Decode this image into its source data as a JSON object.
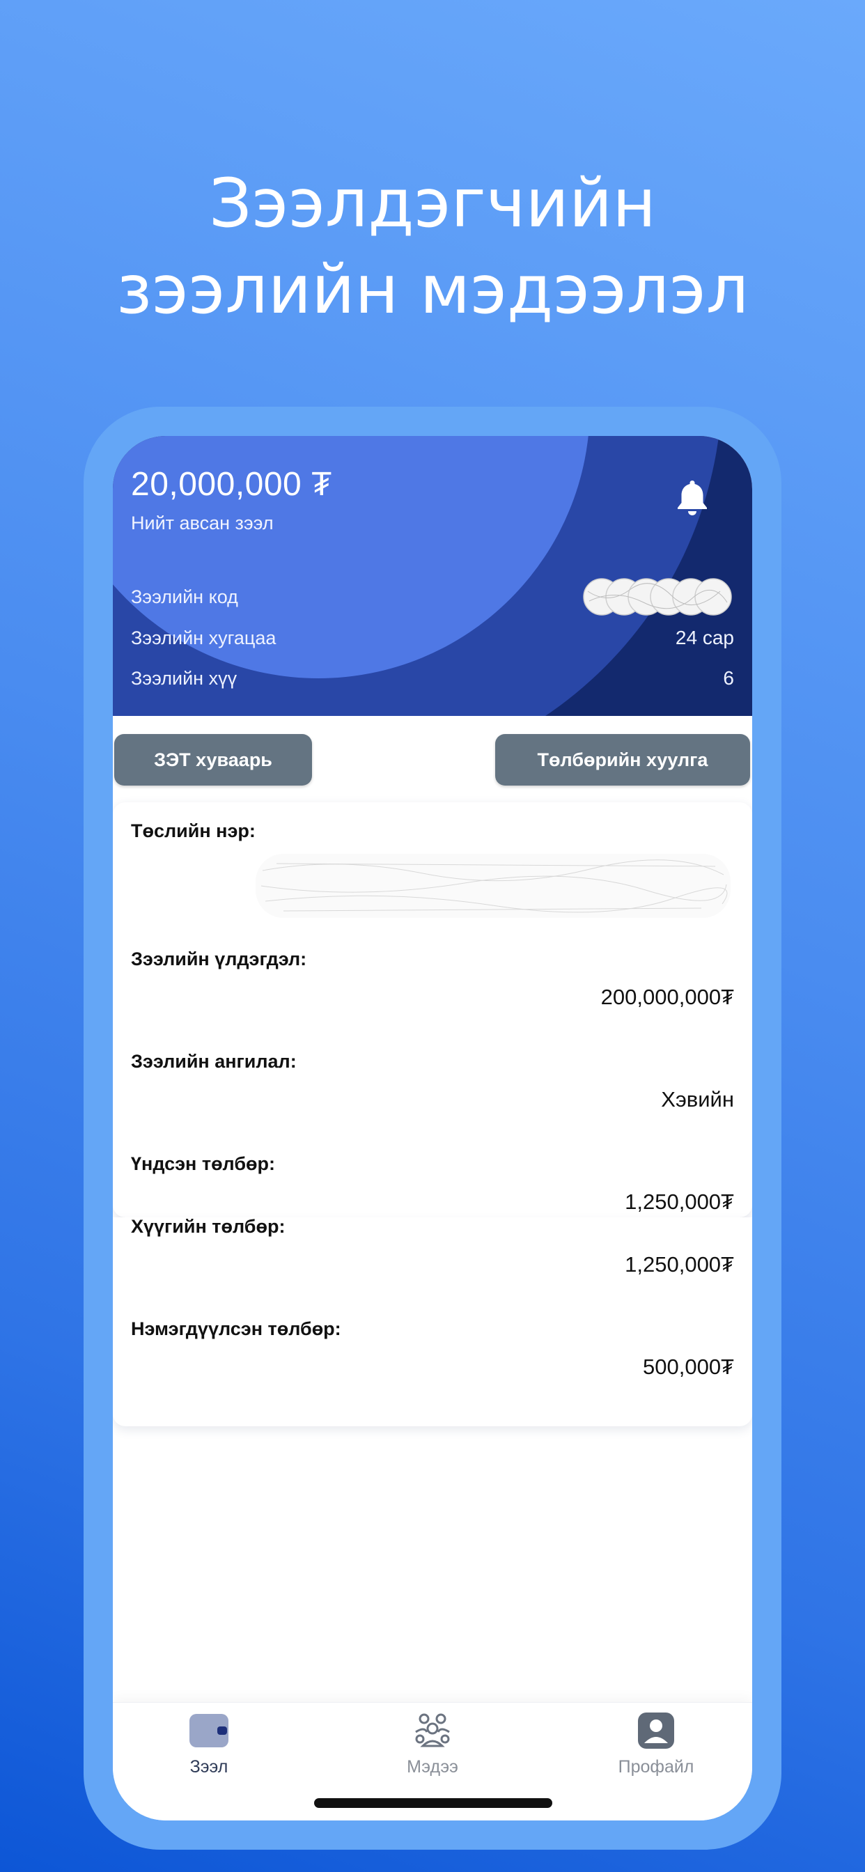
{
  "headline": {
    "line1": "Зээлдэгчийн",
    "line2": "зээлийн мэдээлэл"
  },
  "loan_card": {
    "amount": "20,000,000 ₮",
    "total_label": "Нийт авсан зээл",
    "notification_icon": "bell-icon",
    "rows": [
      {
        "label": "Зээлийн код",
        "value": ""
      },
      {
        "label": "Зээлийн хугацаа",
        "value": "24 сар"
      },
      {
        "label": "Зээлийн хүү",
        "value": "6"
      }
    ]
  },
  "buttons": {
    "schedule": "ЗЭТ хуваарь",
    "statement": "Төлбөрийн хуулга"
  },
  "details": [
    {
      "label": "Төслийн нэр:",
      "value": ""
    },
    {
      "label": "Зээлийн үлдэгдэл:",
      "value": "200,000,000₮"
    },
    {
      "label": "Зээлийн ангилал:",
      "value": "Хэвийн"
    },
    {
      "label": "Үндсэн төлбөр:",
      "value": "1,250,000₮"
    },
    {
      "label": "Хүүгийн төлбөр:",
      "value": "1,250,000₮"
    },
    {
      "label": "Нэмэгдүүлсэн төлбөр:",
      "value": "500,000₮"
    }
  ],
  "tabbar": {
    "items": [
      {
        "label": "Зээл",
        "icon": "wallet-icon",
        "active": true
      },
      {
        "label": "Мэдээ",
        "icon": "people-icon",
        "active": false
      },
      {
        "label": "Профайл",
        "icon": "profile-icon",
        "active": false
      }
    ]
  },
  "colors": {
    "background_gradient_top": "#6aa9fb",
    "background_gradient_bottom": "#0d56d6",
    "hero_dark": "#13296e",
    "hero_mid": "#2947a7",
    "hero_light": "#4f78e5",
    "button": "#647482"
  }
}
